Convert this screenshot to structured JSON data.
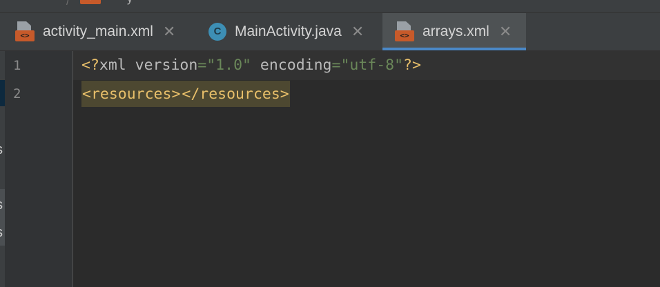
{
  "breadcrumb": {
    "separator": "/",
    "icon_text": "<>",
    "cut_text": "y"
  },
  "tabs": [
    {
      "label": "activity_main.xml",
      "icon": "xml-file-icon",
      "icon_text": "<>",
      "close": "✕",
      "active": false
    },
    {
      "label": "MainActivity.java",
      "icon": "java-class-icon",
      "icon_text": "C",
      "close": "✕",
      "active": false
    },
    {
      "label": "arrays.xml",
      "icon": "xml-file-icon",
      "icon_text": "<>",
      "close": "✕",
      "active": true
    }
  ],
  "left_panel": {
    "fragments": [
      "s",
      "s",
      "s"
    ]
  },
  "editor": {
    "line_numbers": [
      "1",
      "2"
    ],
    "line1": {
      "open": "<?",
      "xml": "xml ",
      "version_attr": "version",
      "eq1": "=",
      "version_val": "\"1.0\"",
      "space": " ",
      "encoding_attr": "encoding",
      "eq2": "=",
      "encoding_val": "\"utf-8\"",
      "close": "?>"
    },
    "line2": {
      "open_tag": "<resources>",
      "close_tag": "</resources>"
    }
  },
  "colors": {
    "background": "#2b2b2b",
    "tab_active_underline": "#4a88c7",
    "xml_badge": "#c75a2a",
    "java_class": "#3d8fb5",
    "tag": "#e8bf6a",
    "string": "#6a8759",
    "attribute": "#bababa",
    "tag_highlight": "#4d4831"
  }
}
